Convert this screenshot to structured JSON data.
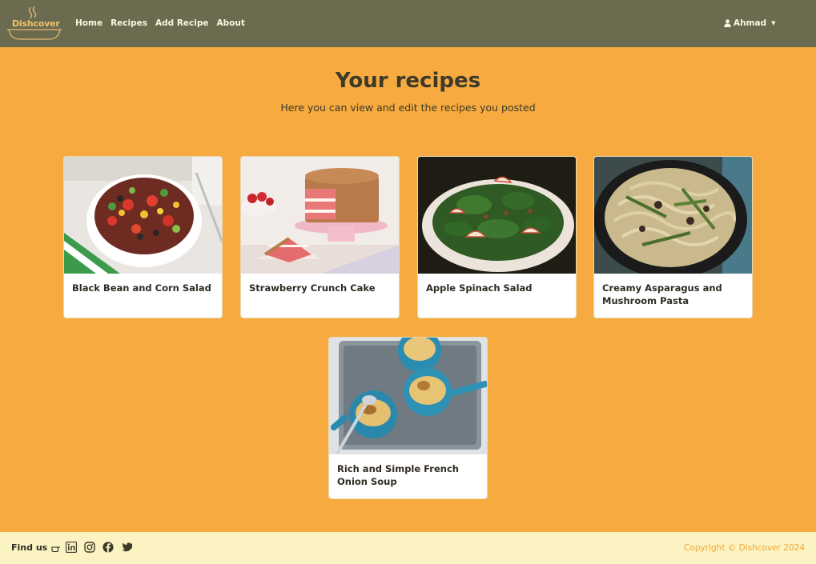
{
  "brand": {
    "name": "Dishcover"
  },
  "nav": {
    "links": [
      {
        "label": "Home"
      },
      {
        "label": "Recipes"
      },
      {
        "label": "Add Recipe"
      },
      {
        "label": "About"
      }
    ],
    "user": {
      "name": "Ahmad",
      "icon": "user-icon"
    }
  },
  "header": {
    "title": "Your recipes",
    "subtitle": "Here you can view and edit the recipes you posted"
  },
  "recipes": [
    {
      "title": "Black Bean and Corn Salad"
    },
    {
      "title": "Strawberry Crunch Cake"
    },
    {
      "title": "Apple Spinach Salad"
    },
    {
      "title": "Creamy Asparagus and Mushroom Pasta"
    },
    {
      "title": "Rich and Simple French Onion Soup"
    }
  ],
  "footer": {
    "find_us": "Find us",
    "socials": [
      "linkedin-icon",
      "instagram-icon",
      "facebook-icon",
      "twitter-icon"
    ],
    "copyright": "Copyright © Dishcover 2024"
  },
  "colors": {
    "navbar": "#6b6b4f",
    "background": "#f6aa3f",
    "footer": "#fbf3c2",
    "accent": "#f0a63a"
  }
}
